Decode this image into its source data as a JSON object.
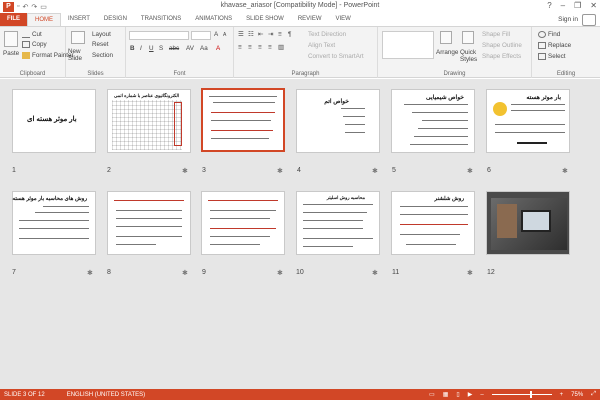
{
  "app": {
    "title": "khavase_ariasor [Compatibility Mode] - PowerPoint"
  },
  "window": {
    "minimize": "–",
    "restore": "❐",
    "close": "✕",
    "help": "?"
  },
  "tabs": [
    "FILE",
    "HOME",
    "INSERT",
    "DESIGN",
    "TRANSITIONS",
    "ANIMATIONS",
    "SLIDE SHOW",
    "REVIEW",
    "VIEW"
  ],
  "signin": "Sign in",
  "ribbon": {
    "clipboard": {
      "label": "Clipboard",
      "paste": "Paste",
      "cut": "Cut",
      "copy": "Copy",
      "format_painter": "Format Painter"
    },
    "slides": {
      "label": "Slides",
      "new_slide": "New Slide",
      "layout": "Layout",
      "reset": "Reset",
      "section": "Section"
    },
    "font": {
      "label": "Font"
    },
    "paragraph": {
      "label": "Paragraph",
      "text_direction": "Text Direction",
      "align_text": "Align Text",
      "convert": "Convert to SmartArt"
    },
    "drawing": {
      "label": "Drawing",
      "arrange": "Arrange",
      "quick_styles": "Quick Styles",
      "shape_fill": "Shape Fill",
      "shape_outline": "Shape Outline",
      "shape_effects": "Shape Effects"
    },
    "editing": {
      "label": "Editing",
      "find": "Find",
      "replace": "Replace",
      "select": "Select"
    }
  },
  "slides": [
    {
      "num": "1",
      "title": "بار موثر هسته ای",
      "star": ""
    },
    {
      "num": "2",
      "title": "الکترونگاتیوی عناصر با شماره اتمی",
      "star": "✱"
    },
    {
      "num": "3",
      "title": "",
      "star": "✱"
    },
    {
      "num": "4",
      "title": "خواص اتم",
      "star": "✱"
    },
    {
      "num": "5",
      "title": "خواص شیمیایی",
      "star": "✱"
    },
    {
      "num": "6",
      "title": "بار موثر هسته",
      "star": "✱"
    },
    {
      "num": "7",
      "title": "روش های محاسبه بار موثر هسته",
      "star": "✱"
    },
    {
      "num": "8",
      "title": "",
      "star": "✱"
    },
    {
      "num": "9",
      "title": "",
      "star": "✱"
    },
    {
      "num": "10",
      "title": "محاسبه روش اسلیتر",
      "star": "✱"
    },
    {
      "num": "11",
      "title": "روش شلشنر",
      "star": "✱"
    },
    {
      "num": "12",
      "title": "",
      "star": ""
    }
  ],
  "status": {
    "slide": "SLIDE 3 OF 12",
    "language": "ENGLISH (UNITED STATES)",
    "zoom": "75%",
    "zoom_minus": "–",
    "zoom_plus": "+"
  }
}
